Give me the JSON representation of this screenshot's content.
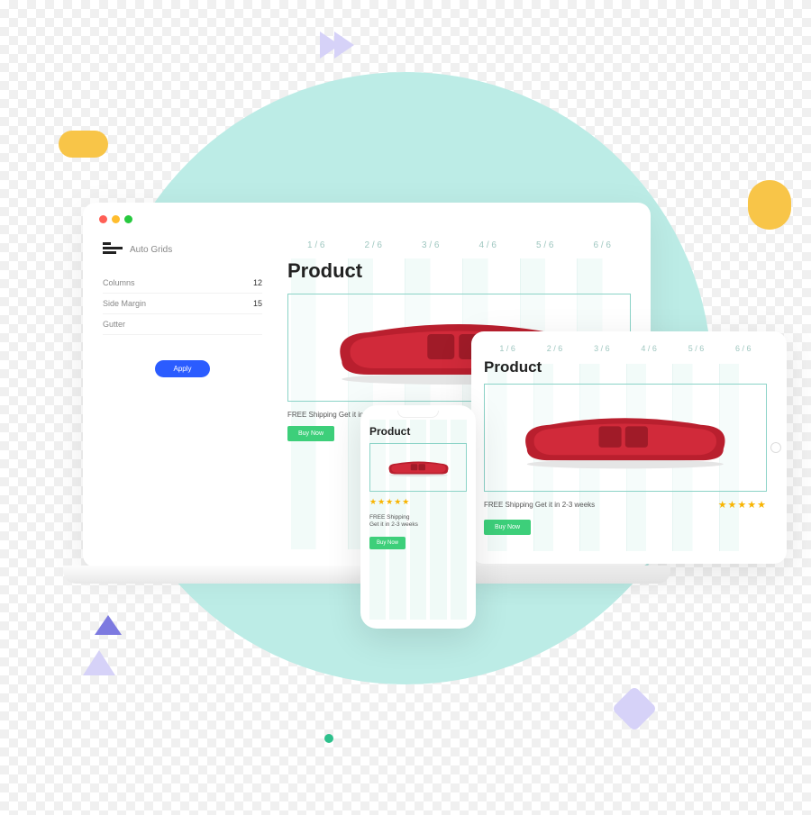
{
  "decor": {},
  "sidebar": {
    "title": "Auto Grids",
    "fields": {
      "columns": {
        "label": "Columns",
        "value": "12"
      },
      "side_margin": {
        "label": "Side Margin",
        "value": "15"
      },
      "gutter": {
        "label": "Gutter",
        "value": ""
      }
    },
    "apply_label": "Apply"
  },
  "grid_labels_6": [
    "1 / 6",
    "2 / 6",
    "3 / 6",
    "4 / 6",
    "5 / 6",
    "6 / 6"
  ],
  "product": {
    "title": "Product",
    "shipping": "FREE Shipping Get it in 2-3 weeks",
    "shipping_2line_a": "FREE Shipping",
    "shipping_2line_b": "Get it in 2-3 weeks",
    "buy_label": "Buy Now",
    "stars": "★★★★★"
  }
}
